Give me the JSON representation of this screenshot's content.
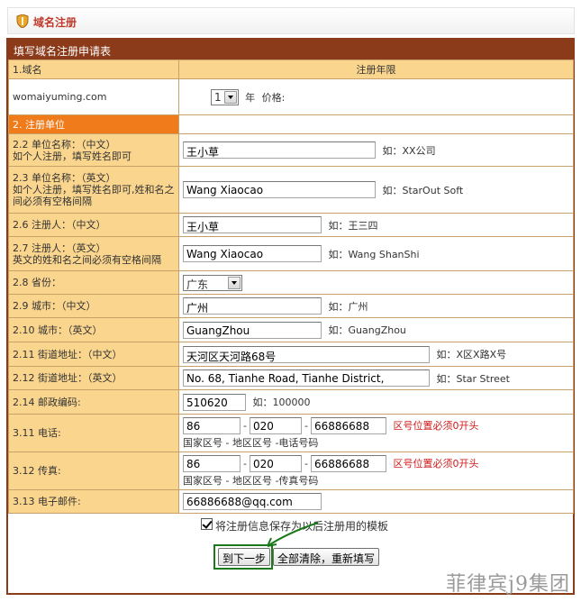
{
  "header": {
    "title": "域名注册"
  },
  "form": {
    "title": "填写域名注册申请表",
    "col_domain": "1.域名",
    "col_years": "注册年限",
    "domain_value": "womaiyuming.com",
    "years_selected": "1",
    "years_unit": "年",
    "price_label": "价格:",
    "section2": "2. 注册单位",
    "rows": {
      "org_cn": {
        "label1": "2.2 单位名称：（中文）",
        "label2": "如个人注册，填写姓名即可",
        "value": "王小草",
        "hint": "如：XX公司"
      },
      "org_en": {
        "label1": "2.3 单位名称：（英文）",
        "label2": "如个人注册，填写姓名即可,姓和名之间必须有空格间隔",
        "value": "Wang Xiaocao",
        "hint": "如：StarOut Soft"
      },
      "reg_cn": {
        "label1": "2.6 注册人：（中文）",
        "value": "王小草",
        "hint": "如：王三四"
      },
      "reg_en": {
        "label1": "2.7 注册人：（英文）",
        "label2": "英文的姓和名之间必须有空格间隔",
        "value": "Wang Xiaocao",
        "hint": "如：Wang ShanShi"
      },
      "province": {
        "label1": "2.8 省份：",
        "value": "广东"
      },
      "city_cn": {
        "label1": "2.9 城市：（中文）",
        "value": "广州",
        "hint": "如：广州"
      },
      "city_en": {
        "label1": "2.10 城市：（英文）",
        "value": "GuangZhou",
        "hint": "如：GuangZhou"
      },
      "addr_cn": {
        "label1": "2.11 街道地址：（中文）",
        "value": "天河区天河路68号",
        "hint": "如：X区X路X号"
      },
      "addr_en": {
        "label1": "2.12 街道地址：（英文）",
        "value": "No. 68, Tianhe Road, Tianhe District,",
        "hint": "如：Star Street"
      },
      "zip": {
        "label1": "2.14 邮政编码:",
        "value": "510620",
        "hint": "如：100000"
      },
      "phone": {
        "label1": "3.11 电话:",
        "country": "86",
        "area": "020",
        "number": "66886688",
        "warn": "区号位置必须0开头",
        "sub": "国家区号 - 地区区号 -电话号码"
      },
      "fax": {
        "label1": "3.12 传真:",
        "country": "86",
        "area": "020",
        "number": "66886688",
        "warn": "区号位置必须0开头",
        "sub": "国家区号 - 地区区号 -传真号码"
      },
      "email": {
        "label1": "3.13 电子邮件:",
        "value": "66886688@qq.com"
      }
    },
    "dash": "-",
    "save_template_label": "将注册信息保存为以后注册用的模板",
    "next_button": "到下一步",
    "reset_button": "全部清除，重新填写"
  },
  "watermark": "菲律宾j9集团",
  "colors": {
    "frame": "#8b3a1a",
    "label_bg": "#fad58e",
    "section_bg": "#f07b1b",
    "warn": "#d11a1a",
    "highlight": "#1a7a1a"
  }
}
